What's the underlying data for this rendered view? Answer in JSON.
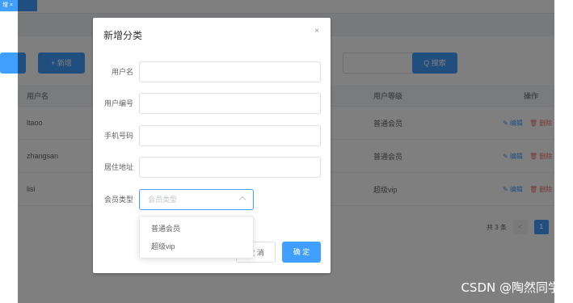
{
  "background": {
    "tag_label": "增 ×",
    "toolbar": {
      "add_label": "+ 新增",
      "search_label": "Q 搜索"
    },
    "table": {
      "headers": {
        "username": "用户名",
        "level": "用户等级",
        "ops": "操作"
      },
      "rows": [
        {
          "username": "ltaoo",
          "level": "普通会员",
          "edit": "✎ 编辑",
          "delete": "🗑 删除"
        },
        {
          "username": "zhangsan",
          "level": "普通会员",
          "edit": "✎ 编辑",
          "delete": "🗑 删除"
        },
        {
          "username": "lisi",
          "level": "超级vip",
          "edit": "✎ 编辑",
          "delete": "🗑 删除"
        }
      ]
    },
    "pager": {
      "total": "共 3 条",
      "prev": "<",
      "current": "1"
    }
  },
  "dialog": {
    "title": "新增分类",
    "close": "×",
    "fields": {
      "username": {
        "label": "用户名",
        "value": ""
      },
      "user_no": {
        "label": "用户编号",
        "value": ""
      },
      "phone": {
        "label": "手机号码",
        "value": ""
      },
      "address": {
        "label": "居住地址",
        "value": ""
      },
      "member_type": {
        "label": "会员类型",
        "placeholder": "会员类型"
      }
    },
    "cancel_label": "取 消",
    "ok_label": "确 定"
  },
  "dropdown": {
    "options": [
      "普通会员",
      "超级vip"
    ]
  },
  "watermark": "CSDN @陶然同学",
  "colors": {
    "primary": "#409eff",
    "danger": "#f56c6c",
    "overlay": "rgba(0,0,0,0.5)"
  }
}
